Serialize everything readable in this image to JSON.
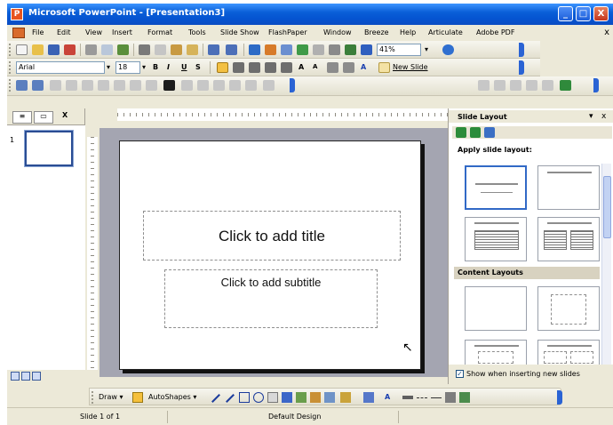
{
  "window": {
    "title": "Microsoft PowerPoint - [Presentation3]",
    "minimize_glyph": "_",
    "maximize_glyph": "□",
    "close_glyph": "X"
  },
  "menubar": {
    "items": [
      "File",
      "Edit",
      "View",
      "Insert",
      "Format",
      "Tools",
      "Slide Show",
      "FlashPaper",
      "Window",
      "Breeze",
      "Help",
      "Articulate",
      "Adobe PDF"
    ],
    "close_glyph": "x"
  },
  "toolbar_standard": {
    "zoom": "41%",
    "icons": [
      "new-icon",
      "open-icon",
      "save-icon",
      "permission-icon",
      "print-icon",
      "print-preview-icon",
      "spelling-icon",
      "cut-icon",
      "copy-icon",
      "paste-icon",
      "format-painter-icon",
      "undo-icon",
      "redo-icon",
      "hyperlink-icon",
      "tables-borders-icon",
      "insert-table-icon",
      "insert-chart-icon",
      "expand-all-icon",
      "show-formatting-icon",
      "grid-icon",
      "color-grayscale-icon",
      "help-icon"
    ]
  },
  "toolbar_formatting": {
    "font_name": "Arial",
    "font_size": "18",
    "bold": "B",
    "italic": "I",
    "underline": "U",
    "shadow": "S",
    "new_slide_label": "New Slide",
    "font_color_glyph": "A"
  },
  "outline_pane": {
    "close_glyph": "X",
    "slide_number": "1"
  },
  "slide": {
    "title_placeholder": "Click to add title",
    "subtitle_placeholder": "Click to add subtitle"
  },
  "task_pane": {
    "title": "Slide Layout",
    "dropdown_glyph": "▾",
    "close_glyph": "x",
    "apply_label": "Apply slide layout:",
    "section_content": "Content Layouts",
    "show_checkbox_label": "Show when inserting new slides",
    "show_checkbox_checked": true
  },
  "drawing_toolbar": {
    "draw_label": "Draw ▾",
    "autoshapes_label": "AutoShapes ▾"
  },
  "statusbar": {
    "slide_indicator": "Slide 1 of 1",
    "design_name": "Default Design"
  },
  "colors": {
    "titlebar": "#0a5fd8",
    "slide_area_bg": "#a4a5b1",
    "selection_border": "#3169c6"
  }
}
